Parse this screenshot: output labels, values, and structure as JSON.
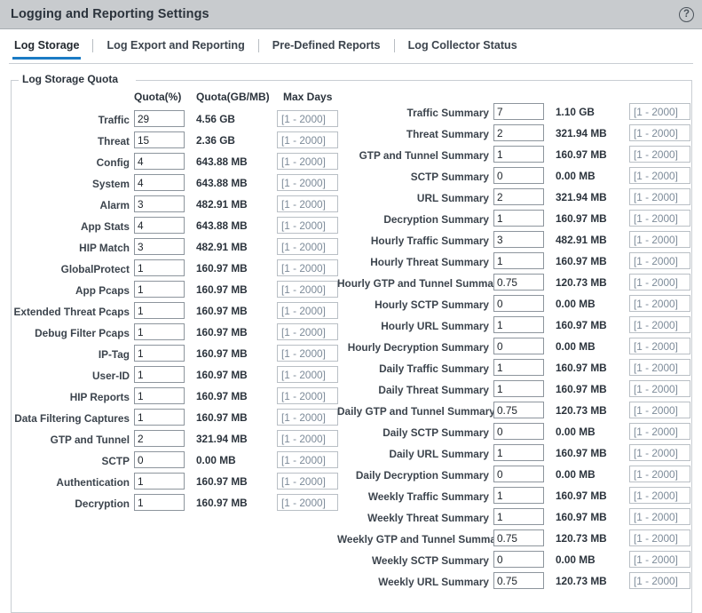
{
  "window": {
    "title": "Logging and Reporting Settings",
    "help_icon": "help-circle-icon",
    "help_glyph": "?"
  },
  "tabs": [
    {
      "label": "Log Storage",
      "active": true
    },
    {
      "label": "Log Export and Reporting",
      "active": false
    },
    {
      "label": "Pre-Defined Reports",
      "active": false
    },
    {
      "label": "Log Collector Status",
      "active": false
    }
  ],
  "panel": {
    "legend": "Log Storage Quota",
    "columns": {
      "quota_percent": "Quota(%)",
      "quota_size": "Quota(GB/MB)",
      "max_days": "Max Days"
    },
    "max_days_placeholder": "[1 - 2000]"
  },
  "left_rows": [
    {
      "label": "Traffic",
      "quota_percent": "29",
      "quota_size": "4.56 GB",
      "max_days": ""
    },
    {
      "label": "Threat",
      "quota_percent": "15",
      "quota_size": "2.36 GB",
      "max_days": ""
    },
    {
      "label": "Config",
      "quota_percent": "4",
      "quota_size": "643.88 MB",
      "max_days": ""
    },
    {
      "label": "System",
      "quota_percent": "4",
      "quota_size": "643.88 MB",
      "max_days": ""
    },
    {
      "label": "Alarm",
      "quota_percent": "3",
      "quota_size": "482.91 MB",
      "max_days": ""
    },
    {
      "label": "App Stats",
      "quota_percent": "4",
      "quota_size": "643.88 MB",
      "max_days": ""
    },
    {
      "label": "HIP Match",
      "quota_percent": "3",
      "quota_size": "482.91 MB",
      "max_days": ""
    },
    {
      "label": "GlobalProtect",
      "quota_percent": "1",
      "quota_size": "160.97 MB",
      "max_days": ""
    },
    {
      "label": "App Pcaps",
      "quota_percent": "1",
      "quota_size": "160.97 MB",
      "max_days": ""
    },
    {
      "label": "Extended Threat Pcaps",
      "quota_percent": "1",
      "quota_size": "160.97 MB",
      "max_days": ""
    },
    {
      "label": "Debug Filter Pcaps",
      "quota_percent": "1",
      "quota_size": "160.97 MB",
      "max_days": ""
    },
    {
      "label": "IP-Tag",
      "quota_percent": "1",
      "quota_size": "160.97 MB",
      "max_days": ""
    },
    {
      "label": "User-ID",
      "quota_percent": "1",
      "quota_size": "160.97 MB",
      "max_days": ""
    },
    {
      "label": "HIP Reports",
      "quota_percent": "1",
      "quota_size": "160.97 MB",
      "max_days": ""
    },
    {
      "label": "Data Filtering Captures",
      "quota_percent": "1",
      "quota_size": "160.97 MB",
      "max_days": ""
    },
    {
      "label": "GTP and Tunnel",
      "quota_percent": "2",
      "quota_size": "321.94 MB",
      "max_days": ""
    },
    {
      "label": "SCTP",
      "quota_percent": "0",
      "quota_size": "0.00 MB",
      "max_days": ""
    },
    {
      "label": "Authentication",
      "quota_percent": "1",
      "quota_size": "160.97 MB",
      "max_days": ""
    },
    {
      "label": "Decryption",
      "quota_percent": "1",
      "quota_size": "160.97 MB",
      "max_days": ""
    }
  ],
  "right_rows": [
    {
      "label": "Traffic Summary",
      "quota_percent": "7",
      "quota_size": "1.10 GB",
      "max_days": ""
    },
    {
      "label": "Threat Summary",
      "quota_percent": "2",
      "quota_size": "321.94 MB",
      "max_days": ""
    },
    {
      "label": "GTP and Tunnel Summary",
      "quota_percent": "1",
      "quota_size": "160.97 MB",
      "max_days": ""
    },
    {
      "label": "SCTP Summary",
      "quota_percent": "0",
      "quota_size": "0.00 MB",
      "max_days": ""
    },
    {
      "label": "URL Summary",
      "quota_percent": "2",
      "quota_size": "321.94 MB",
      "max_days": ""
    },
    {
      "label": "Decryption Summary",
      "quota_percent": "1",
      "quota_size": "160.97 MB",
      "max_days": ""
    },
    {
      "label": "Hourly Traffic Summary",
      "quota_percent": "3",
      "quota_size": "482.91 MB",
      "max_days": ""
    },
    {
      "label": "Hourly Threat Summary",
      "quota_percent": "1",
      "quota_size": "160.97 MB",
      "max_days": ""
    },
    {
      "label": "Hourly GTP and Tunnel Summary",
      "quota_percent": "0.75",
      "quota_size": "120.73 MB",
      "max_days": ""
    },
    {
      "label": "Hourly SCTP Summary",
      "quota_percent": "0",
      "quota_size": "0.00 MB",
      "max_days": ""
    },
    {
      "label": "Hourly URL Summary",
      "quota_percent": "1",
      "quota_size": "160.97 MB",
      "max_days": ""
    },
    {
      "label": "Hourly Decryption Summary",
      "quota_percent": "0",
      "quota_size": "0.00 MB",
      "max_days": ""
    },
    {
      "label": "Daily Traffic Summary",
      "quota_percent": "1",
      "quota_size": "160.97 MB",
      "max_days": ""
    },
    {
      "label": "Daily Threat Summary",
      "quota_percent": "1",
      "quota_size": "160.97 MB",
      "max_days": ""
    },
    {
      "label": "Daily GTP and Tunnel Summary",
      "quota_percent": "0.75",
      "quota_size": "120.73 MB",
      "max_days": ""
    },
    {
      "label": "Daily SCTP Summary",
      "quota_percent": "0",
      "quota_size": "0.00 MB",
      "max_days": ""
    },
    {
      "label": "Daily URL Summary",
      "quota_percent": "1",
      "quota_size": "160.97 MB",
      "max_days": ""
    },
    {
      "label": "Daily Decryption Summary",
      "quota_percent": "0",
      "quota_size": "0.00 MB",
      "max_days": ""
    },
    {
      "label": "Weekly Traffic Summary",
      "quota_percent": "1",
      "quota_size": "160.97 MB",
      "max_days": ""
    },
    {
      "label": "Weekly Threat Summary",
      "quota_percent": "1",
      "quota_size": "160.97 MB",
      "max_days": ""
    },
    {
      "label": "Weekly GTP and Tunnel Summary",
      "quota_percent": "0.75",
      "quota_size": "120.73 MB",
      "max_days": ""
    },
    {
      "label": "Weekly SCTP Summary",
      "quota_percent": "0",
      "quota_size": "0.00 MB",
      "max_days": ""
    },
    {
      "label": "Weekly URL Summary",
      "quota_percent": "0.75",
      "quota_size": "120.73 MB",
      "max_days": ""
    }
  ],
  "colors": {
    "titlebar": "#c8cbce",
    "accent": "#1a7bc4",
    "text": "#3c444d",
    "placeholder": "#7d8b99",
    "border": "#c9ced3"
  }
}
